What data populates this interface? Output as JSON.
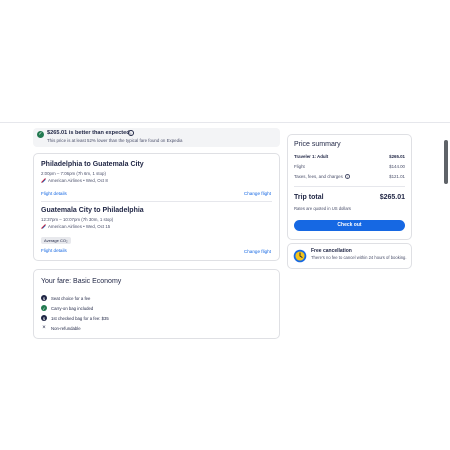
{
  "banner": {
    "title": "$265.01 is better than expected",
    "subtitle": "This price is at least 52% lower than the typical fare found on Expedia"
  },
  "flights": [
    {
      "route": "Philadelphia to Guatemala City",
      "time": "2:00pm – 7:06pm (7h 6m, 1 stop)",
      "airline": "American Airlines • Wed, Oct 8",
      "details_label": "Flight details",
      "change_label": "Change flight"
    },
    {
      "route": "Guatemala City to Philadelphia",
      "time": "12:37pm – 10:07pm (7h 30m, 1 stop)",
      "airline": "American Airlines • Wed, Oct 15",
      "badge": "Average CO₂",
      "details_label": "Flight details",
      "change_label": "Change flight"
    }
  ],
  "fare": {
    "title": "Your fare: Basic Economy",
    "items": [
      {
        "text": "Seat choice for a fee",
        "icon": "seat-fee-icon"
      },
      {
        "text": "Carry-on bag included",
        "icon": "check-icon"
      },
      {
        "text": "1st checked bag for a fee: $35",
        "icon": "bag-fee-icon"
      },
      {
        "text": "Non-refundable",
        "icon": "cross-icon"
      }
    ]
  },
  "summary": {
    "title": "Price summary",
    "traveler_label": "Traveler 1: Adult",
    "traveler_value": "$265.01",
    "flight_label": "Flight",
    "flight_value": "$144.00",
    "taxes_label": "Taxes, fees, and charges",
    "taxes_value": "$121.01",
    "total_label": "Trip total",
    "total_value": "$265.01",
    "rates_note": "Rates are quoted in US dollars",
    "checkout_label": "Check out"
  },
  "cancellation": {
    "title": "Free cancellation",
    "text": "There's no fee to cancel within 24 hours of booking."
  },
  "colors": {
    "accent": "#1668e3",
    "success": "#227950",
    "text": "#1f2544"
  }
}
